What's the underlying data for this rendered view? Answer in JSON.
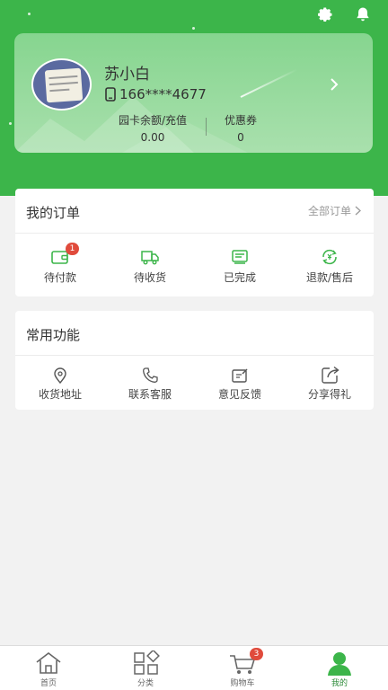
{
  "profile": {
    "name": "苏小白",
    "phone": "166****4677",
    "balance_label": "园卡余额/充值",
    "balance_value": "0.00",
    "coupon_label": "优惠券",
    "coupon_value": "0"
  },
  "orders": {
    "title": "我的订单",
    "all_link": "全部订单",
    "items": [
      {
        "label": "待付款",
        "icon": "wallet-icon",
        "badge": "1"
      },
      {
        "label": "待收货",
        "icon": "truck-icon"
      },
      {
        "label": "已完成",
        "icon": "receipt-icon"
      },
      {
        "label": "退款/售后",
        "icon": "refund-icon"
      }
    ]
  },
  "features": {
    "title": "常用功能",
    "items": [
      {
        "label": "收货地址",
        "icon": "location-icon"
      },
      {
        "label": "联系客服",
        "icon": "phone-icon"
      },
      {
        "label": "意见反馈",
        "icon": "edit-icon"
      },
      {
        "label": "分享得礼",
        "icon": "share-icon"
      }
    ]
  },
  "tabbar": {
    "items": [
      {
        "label": "首页",
        "icon": "home-icon"
      },
      {
        "label": "分类",
        "icon": "category-icon"
      },
      {
        "label": "购物车",
        "icon": "cart-icon",
        "badge": "3"
      },
      {
        "label": "我的",
        "icon": "user-icon",
        "active": true
      }
    ]
  },
  "colors": {
    "brand_green": "#3cb54a",
    "badge_red": "#e04b3c",
    "active_tab": "#2e8b3a"
  }
}
